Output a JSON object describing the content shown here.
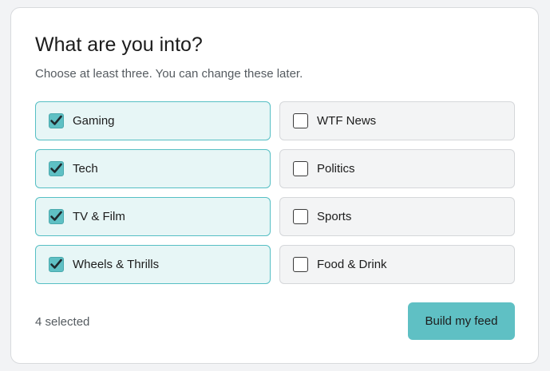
{
  "header": {
    "title": "What are you into?",
    "subtitle": "Choose at least three. You can change these later."
  },
  "options": [
    {
      "label": "Gaming",
      "selected": true,
      "icon": "check-icon"
    },
    {
      "label": "WTF News",
      "selected": false
    },
    {
      "label": "Tech",
      "selected": true,
      "icon": "check-icon"
    },
    {
      "label": "Politics",
      "selected": false
    },
    {
      "label": "TV & Film",
      "selected": true,
      "icon": "check-icon"
    },
    {
      "label": "Sports",
      "selected": false
    },
    {
      "label": "Wheels & Thrills",
      "selected": true,
      "icon": "check-icon"
    },
    {
      "label": "Food & Drink",
      "selected": false
    }
  ],
  "footer": {
    "selected_count": "4 selected",
    "cta_label": "Build my feed"
  },
  "colors": {
    "accent": "#5fc0c4",
    "selected_bg": "#e7f6f6",
    "selected_border": "#56bfc4",
    "unselected_bg": "#f3f4f5"
  }
}
